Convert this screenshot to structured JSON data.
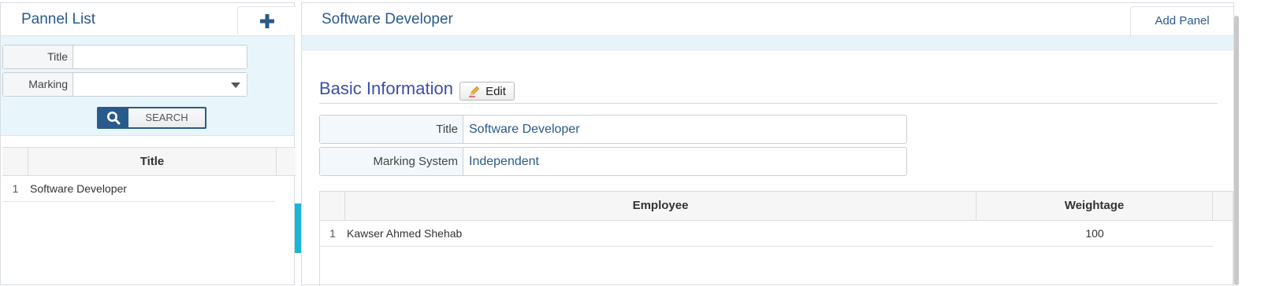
{
  "left": {
    "title": "Pannel List",
    "add_icon": "plus-icon",
    "filters": {
      "title_label": "Title",
      "title_value": "",
      "marking_label": "Marking",
      "marking_value": "",
      "search_icon": "search-icon",
      "search_label": "SEARCH"
    },
    "grid": {
      "column": "Title",
      "rows": [
        {
          "num": "1",
          "title": "Software Developer"
        }
      ]
    }
  },
  "right": {
    "title": "Software Developer",
    "add_panel_label": "Add Panel",
    "section_title": "Basic Information",
    "edit_icon": "pencil-icon",
    "edit_label": "Edit",
    "info": {
      "title_label": "Title",
      "title_value": "Software Developer",
      "marking_label": "Marking System",
      "marking_value": "Independent"
    },
    "employees": {
      "columns": [
        "Employee",
        "Weightage"
      ],
      "rows": [
        {
          "num": "1",
          "employee": "Kawser Ahmed Shehab",
          "weightage": "100"
        }
      ]
    }
  },
  "colors": {
    "accent": "#2a5a8c",
    "filter_bg": "#e8f5fb",
    "splitter": "#1bb5d6",
    "section_title": "#3b4fa8"
  }
}
